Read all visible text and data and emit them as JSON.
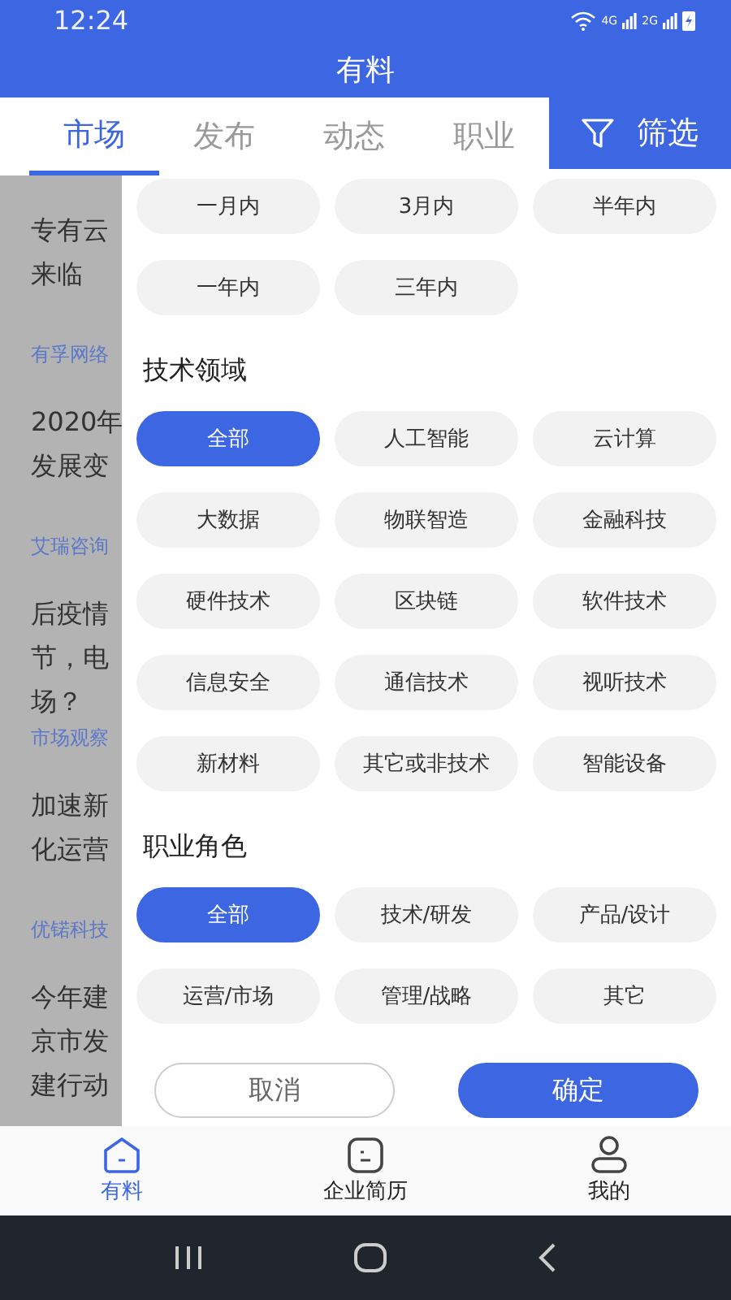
{
  "status_bar": {
    "time": "12:24",
    "networks": [
      "4G",
      "2G"
    ]
  },
  "title": "有料",
  "tabs": [
    {
      "label": "市场",
      "selected": true
    },
    {
      "label": "发布",
      "selected": false
    },
    {
      "label": "动态",
      "selected": false
    },
    {
      "label": "职业",
      "selected": false
    }
  ],
  "filter_button": {
    "label": "筛选"
  },
  "articles": [
    {
      "title_lines": [
        "专有云",
        "来临"
      ],
      "source": "有孚网络"
    },
    {
      "title_lines": [
        "2020年",
        "发展变"
      ],
      "source": "艾瑞咨询"
    },
    {
      "title_lines": [
        "后疫情",
        "节，电",
        "场？"
      ],
      "source": "市场观察"
    },
    {
      "title_lines": [
        "加速新",
        "化运营"
      ],
      "source": "优锘科技"
    },
    {
      "title_lines": [
        "今年建",
        "京市发",
        "建行动"
      ]
    }
  ],
  "filter_groups": [
    {
      "options": [
        {
          "label": "一月内",
          "selected": false
        },
        {
          "label": "3月内",
          "selected": false
        },
        {
          "label": "半年内",
          "selected": false
        },
        {
          "label": "一年内",
          "selected": false
        },
        {
          "label": "三年内",
          "selected": false
        }
      ]
    },
    {
      "title": "技术领域",
      "options": [
        {
          "label": "全部",
          "selected": true
        },
        {
          "label": "人工智能",
          "selected": false
        },
        {
          "label": "云计算",
          "selected": false
        },
        {
          "label": "大数据",
          "selected": false
        },
        {
          "label": "物联智造",
          "selected": false
        },
        {
          "label": "金融科技",
          "selected": false
        },
        {
          "label": "硬件技术",
          "selected": false
        },
        {
          "label": "区块链",
          "selected": false
        },
        {
          "label": "软件技术",
          "selected": false
        },
        {
          "label": "信息安全",
          "selected": false
        },
        {
          "label": "通信技术",
          "selected": false
        },
        {
          "label": "视听技术",
          "selected": false
        },
        {
          "label": "新材料",
          "selected": false
        },
        {
          "label": "其它或非技术",
          "selected": false
        },
        {
          "label": "智能设备",
          "selected": false
        }
      ]
    },
    {
      "title": "职业角色",
      "options": [
        {
          "label": "全部",
          "selected": true
        },
        {
          "label": "技术/研发",
          "selected": false
        },
        {
          "label": "产品/设计",
          "selected": false
        },
        {
          "label": "运营/市场",
          "selected": false
        },
        {
          "label": "管理/战略",
          "selected": false
        },
        {
          "label": "其它",
          "selected": false
        }
      ]
    }
  ],
  "actions": {
    "cancel": "取消",
    "confirm": "确定"
  },
  "bottom_nav": [
    {
      "label": "有料",
      "selected": true
    },
    {
      "label": "企业简历",
      "selected": false
    },
    {
      "label": "我的",
      "selected": false
    }
  ]
}
